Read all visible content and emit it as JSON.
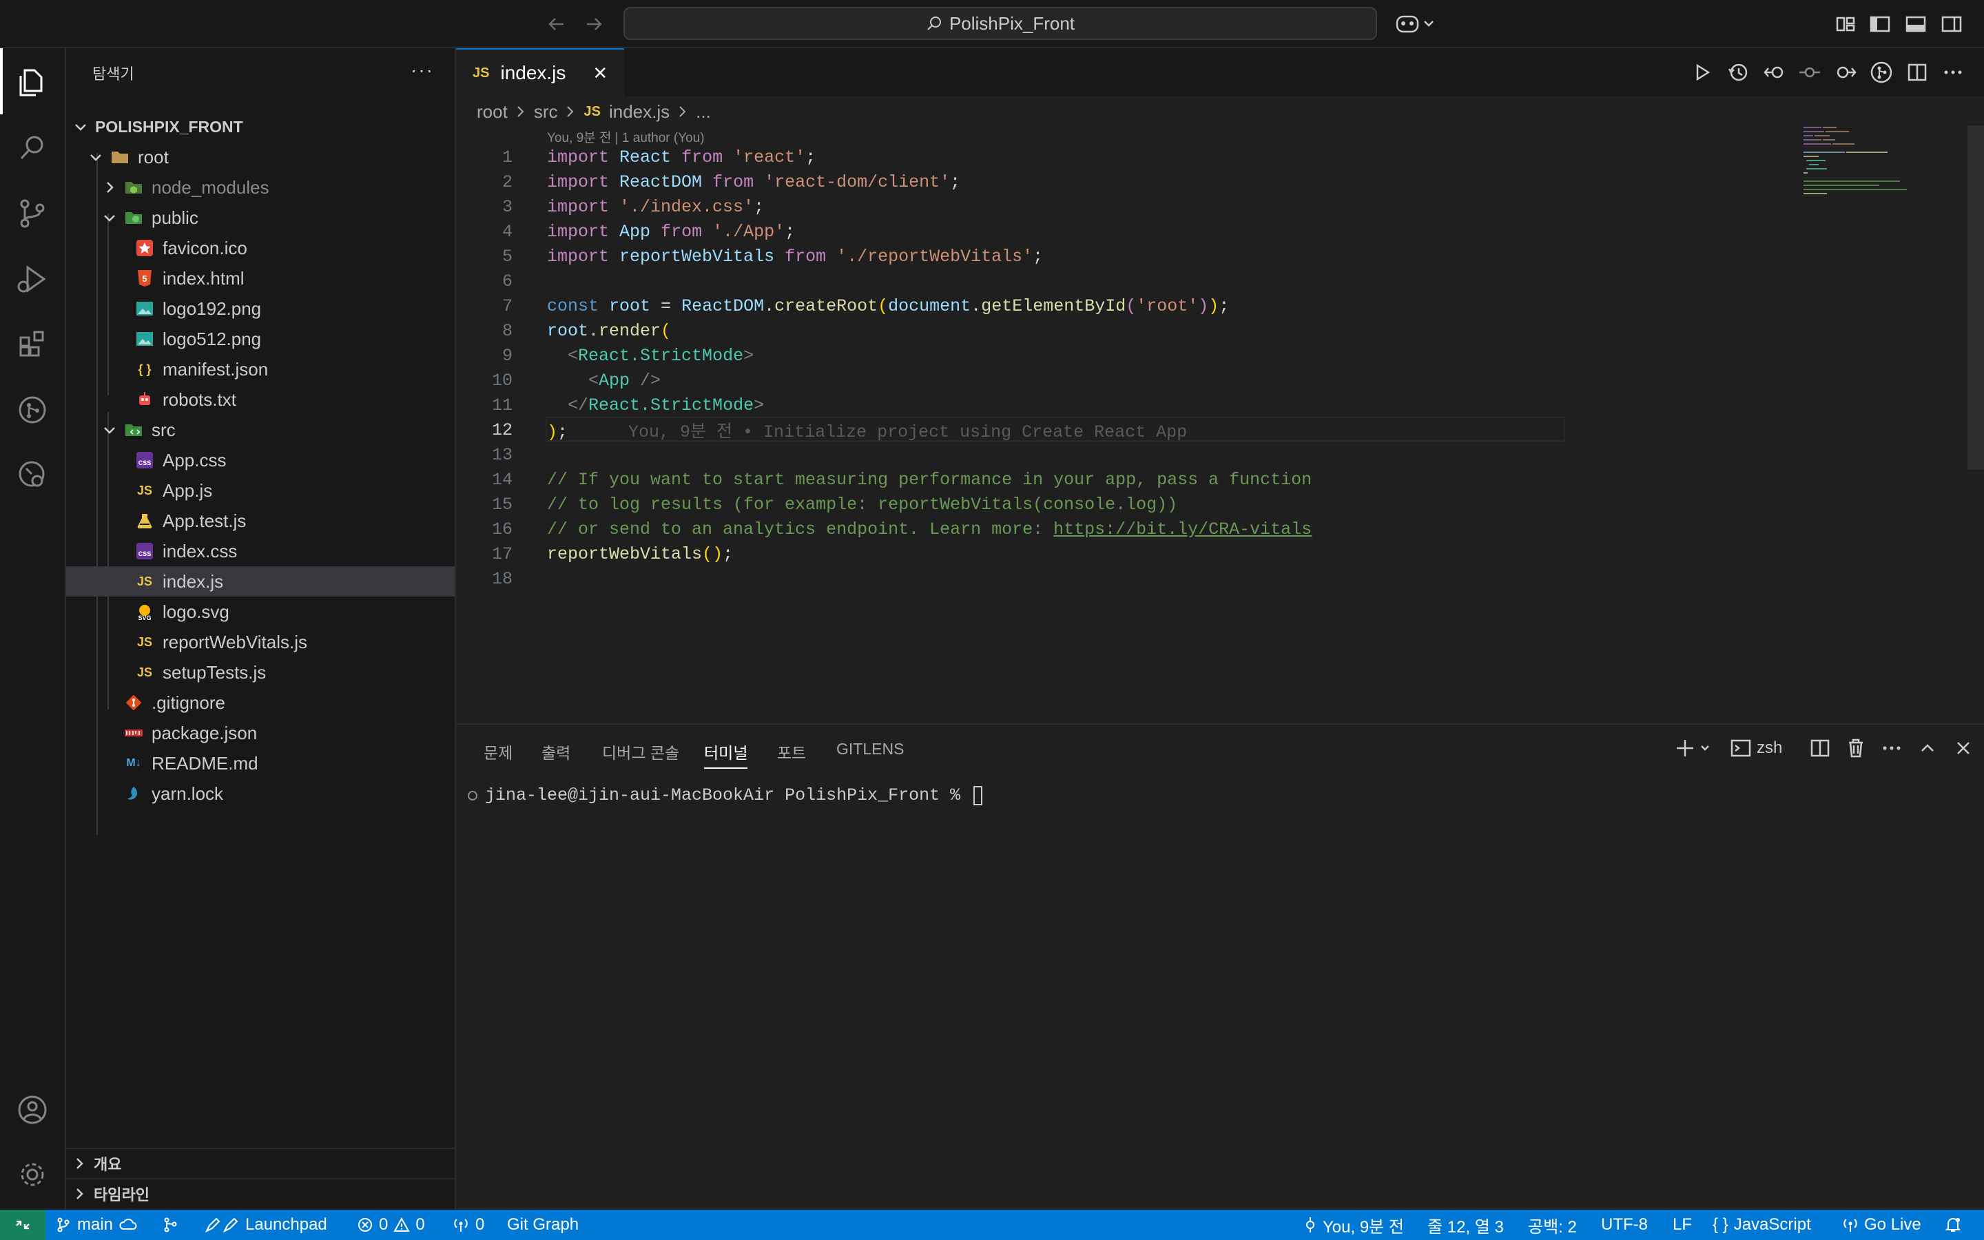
{
  "titlebar": {
    "search_text": "PolishPix_Front",
    "icons": [
      "arrow-left-icon",
      "arrow-right-icon",
      "copilot-icon",
      "layout-customize-icon",
      "toggle-sidebar-icon",
      "toggle-panel-icon",
      "toggle-secondary-sidebar-icon"
    ]
  },
  "activitybar": {
    "items": [
      "explorer-icon",
      "search-icon",
      "source-control-icon",
      "run-debug-icon",
      "extensions-icon",
      "gitlens-icon",
      "remote-explorer-icon"
    ],
    "bottom_items": [
      "accounts-icon",
      "manage-gear-icon"
    ]
  },
  "sidebar": {
    "title": "탐색기",
    "more": "···",
    "root_folder": "POLISHPIX_FRONT",
    "tree": [
      {
        "label": "root",
        "type": "folder-open"
      },
      {
        "label": "node_modules",
        "type": "folder-closed"
      },
      {
        "label": "public",
        "type": "folder-open"
      },
      {
        "label": "favicon.ico",
        "type": "file"
      },
      {
        "label": "index.html",
        "type": "file"
      },
      {
        "label": "logo192.png",
        "type": "file"
      },
      {
        "label": "logo512.png",
        "type": "file"
      },
      {
        "label": "manifest.json",
        "type": "file"
      },
      {
        "label": "robots.txt",
        "type": "file"
      },
      {
        "label": "src",
        "type": "folder-open"
      },
      {
        "label": "App.css",
        "type": "file"
      },
      {
        "label": "App.js",
        "type": "file"
      },
      {
        "label": "App.test.js",
        "type": "file"
      },
      {
        "label": "index.css",
        "type": "file"
      },
      {
        "label": "index.js",
        "type": "file",
        "selected": true
      },
      {
        "label": "logo.svg",
        "type": "file"
      },
      {
        "label": "reportWebVitals.js",
        "type": "file"
      },
      {
        "label": "setupTests.js",
        "type": "file"
      },
      {
        "label": ".gitignore",
        "type": "file"
      },
      {
        "label": "package.json",
        "type": "file"
      },
      {
        "label": "README.md",
        "type": "file"
      },
      {
        "label": "yarn.lock",
        "type": "file"
      }
    ],
    "icon_badges": {
      "js": "JS",
      "css": "CSS",
      "json": "{ }",
      "svg": "SVG",
      "md": "M↓"
    },
    "outline": "개요",
    "timeline": "타임라인"
  },
  "editor": {
    "tab": {
      "badge": "JS",
      "label": "index.js",
      "close": "×"
    },
    "breadcrumb": [
      "root",
      "src",
      "index.js",
      "..."
    ],
    "breadcrumb_badge": "JS",
    "blame_header": "You, 9분 전 | 1 author (You)",
    "inline_blame": "You, 9분 전 • Initialize project using Create React App",
    "active_line": 12,
    "line_numbers": [
      "1",
      "2",
      "3",
      "4",
      "5",
      "6",
      "7",
      "8",
      "9",
      "10",
      "11",
      "12",
      "13",
      "14",
      "15",
      "16",
      "17",
      "18"
    ],
    "code": {
      "l1": [
        "import",
        " ",
        "React",
        " ",
        "from",
        " ",
        "'react'",
        ";"
      ],
      "l2": [
        "import",
        " ",
        "ReactDOM",
        " ",
        "from",
        " ",
        "'react-dom/client'",
        ";"
      ],
      "l3": [
        "import",
        " ",
        "'./index.css'",
        ";"
      ],
      "l4": [
        "import",
        " ",
        "App",
        " ",
        "from",
        " ",
        "'./App'",
        ";"
      ],
      "l5": [
        "import",
        " ",
        "reportWebVitals",
        " ",
        "from",
        " ",
        "'./reportWebVitals'",
        ";"
      ],
      "l7": [
        "const",
        " ",
        "root",
        " = ",
        "ReactDOM",
        ".",
        "createRoot",
        "(",
        "document",
        ".",
        "getElementById",
        "(",
        "'root'",
        ")",
        ")",
        ";"
      ],
      "l8": [
        "root",
        ".",
        "render",
        "("
      ],
      "l9": [
        "  ",
        "<",
        "React.StrictMode",
        ">"
      ],
      "l10": [
        "    ",
        "<",
        "App",
        " />"
      ],
      "l11": [
        "  ",
        "</",
        "React.StrictMode",
        ">"
      ],
      "l12": [
        ")",
        ";"
      ],
      "l14": "// If you want to start measuring performance in your app, pass a function",
      "l15": "// to log results (for example: reportWebVitals(console.log))",
      "l16_prefix": "// or send to an analytics endpoint. Learn more: ",
      "l16_link": "https://bit.ly/CRA-vitals",
      "l17": [
        "reportWebVitals",
        "(",
        ")",
        ";"
      ]
    },
    "toolbar_icons": [
      "run-icon",
      "timeline-history-icon",
      "open-changes-icon",
      "previous-change-icon",
      "next-change-icon",
      "gitlens-inspect-icon",
      "split-editor-icon",
      "more-actions-icon"
    ]
  },
  "panel": {
    "tabs": [
      "문제",
      "출력",
      "디버그 콘솔",
      "터미널",
      "포트",
      "GITLENS"
    ],
    "active_tab": "터미널",
    "shell": "zsh",
    "terminal_prompt": "jina-lee@ijin-aui-MacBookAir PolishPix_Front % "
  },
  "statusbar": {
    "branch": "main",
    "launchpad": "Launchpad",
    "errors": "0",
    "warnings": "0",
    "ports": "0",
    "git_graph": "Git Graph",
    "blame": "You, 9분 전",
    "position": "줄 12, 열 3",
    "spaces": "공백: 2",
    "encoding": "UTF-8",
    "eol": "LF",
    "language": "JavaScript",
    "language_icon": "{ }",
    "go_live": "Go Live"
  },
  "colors": {
    "accent": "#0078d4",
    "remote": "#16825d",
    "background": "#1f1f1f",
    "sidebar": "#181818"
  }
}
